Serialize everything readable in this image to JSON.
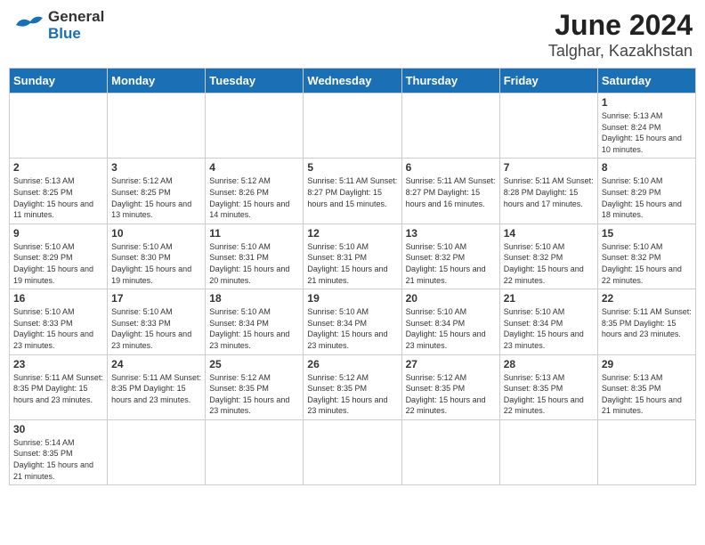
{
  "header": {
    "logo_general": "General",
    "logo_blue": "Blue",
    "month_year": "June 2024",
    "location": "Talghar, Kazakhstan"
  },
  "days_of_week": [
    "Sunday",
    "Monday",
    "Tuesday",
    "Wednesday",
    "Thursday",
    "Friday",
    "Saturday"
  ],
  "weeks": [
    [
      {
        "day": "",
        "info": ""
      },
      {
        "day": "",
        "info": ""
      },
      {
        "day": "",
        "info": ""
      },
      {
        "day": "",
        "info": ""
      },
      {
        "day": "",
        "info": ""
      },
      {
        "day": "",
        "info": ""
      },
      {
        "day": "1",
        "info": "Sunrise: 5:13 AM\nSunset: 8:24 PM\nDaylight: 15 hours\nand 10 minutes."
      }
    ],
    [
      {
        "day": "2",
        "info": "Sunrise: 5:13 AM\nSunset: 8:25 PM\nDaylight: 15 hours\nand 11 minutes."
      },
      {
        "day": "3",
        "info": "Sunrise: 5:12 AM\nSunset: 8:25 PM\nDaylight: 15 hours\nand 13 minutes."
      },
      {
        "day": "4",
        "info": "Sunrise: 5:12 AM\nSunset: 8:26 PM\nDaylight: 15 hours\nand 14 minutes."
      },
      {
        "day": "5",
        "info": "Sunrise: 5:11 AM\nSunset: 8:27 PM\nDaylight: 15 hours\nand 15 minutes."
      },
      {
        "day": "6",
        "info": "Sunrise: 5:11 AM\nSunset: 8:27 PM\nDaylight: 15 hours\nand 16 minutes."
      },
      {
        "day": "7",
        "info": "Sunrise: 5:11 AM\nSunset: 8:28 PM\nDaylight: 15 hours\nand 17 minutes."
      },
      {
        "day": "8",
        "info": "Sunrise: 5:10 AM\nSunset: 8:29 PM\nDaylight: 15 hours\nand 18 minutes."
      }
    ],
    [
      {
        "day": "9",
        "info": "Sunrise: 5:10 AM\nSunset: 8:29 PM\nDaylight: 15 hours\nand 19 minutes."
      },
      {
        "day": "10",
        "info": "Sunrise: 5:10 AM\nSunset: 8:30 PM\nDaylight: 15 hours\nand 19 minutes."
      },
      {
        "day": "11",
        "info": "Sunrise: 5:10 AM\nSunset: 8:31 PM\nDaylight: 15 hours\nand 20 minutes."
      },
      {
        "day": "12",
        "info": "Sunrise: 5:10 AM\nSunset: 8:31 PM\nDaylight: 15 hours\nand 21 minutes."
      },
      {
        "day": "13",
        "info": "Sunrise: 5:10 AM\nSunset: 8:32 PM\nDaylight: 15 hours\nand 21 minutes."
      },
      {
        "day": "14",
        "info": "Sunrise: 5:10 AM\nSunset: 8:32 PM\nDaylight: 15 hours\nand 22 minutes."
      },
      {
        "day": "15",
        "info": "Sunrise: 5:10 AM\nSunset: 8:32 PM\nDaylight: 15 hours\nand 22 minutes."
      }
    ],
    [
      {
        "day": "16",
        "info": "Sunrise: 5:10 AM\nSunset: 8:33 PM\nDaylight: 15 hours\nand 23 minutes."
      },
      {
        "day": "17",
        "info": "Sunrise: 5:10 AM\nSunset: 8:33 PM\nDaylight: 15 hours\nand 23 minutes."
      },
      {
        "day": "18",
        "info": "Sunrise: 5:10 AM\nSunset: 8:34 PM\nDaylight: 15 hours\nand 23 minutes."
      },
      {
        "day": "19",
        "info": "Sunrise: 5:10 AM\nSunset: 8:34 PM\nDaylight: 15 hours\nand 23 minutes."
      },
      {
        "day": "20",
        "info": "Sunrise: 5:10 AM\nSunset: 8:34 PM\nDaylight: 15 hours\nand 23 minutes."
      },
      {
        "day": "21",
        "info": "Sunrise: 5:10 AM\nSunset: 8:34 PM\nDaylight: 15 hours\nand 23 minutes."
      },
      {
        "day": "22",
        "info": "Sunrise: 5:11 AM\nSunset: 8:35 PM\nDaylight: 15 hours\nand 23 minutes."
      }
    ],
    [
      {
        "day": "23",
        "info": "Sunrise: 5:11 AM\nSunset: 8:35 PM\nDaylight: 15 hours\nand 23 minutes."
      },
      {
        "day": "24",
        "info": "Sunrise: 5:11 AM\nSunset: 8:35 PM\nDaylight: 15 hours\nand 23 minutes."
      },
      {
        "day": "25",
        "info": "Sunrise: 5:12 AM\nSunset: 8:35 PM\nDaylight: 15 hours\nand 23 minutes."
      },
      {
        "day": "26",
        "info": "Sunrise: 5:12 AM\nSunset: 8:35 PM\nDaylight: 15 hours\nand 23 minutes."
      },
      {
        "day": "27",
        "info": "Sunrise: 5:12 AM\nSunset: 8:35 PM\nDaylight: 15 hours\nand 22 minutes."
      },
      {
        "day": "28",
        "info": "Sunrise: 5:13 AM\nSunset: 8:35 PM\nDaylight: 15 hours\nand 22 minutes."
      },
      {
        "day": "29",
        "info": "Sunrise: 5:13 AM\nSunset: 8:35 PM\nDaylight: 15 hours\nand 21 minutes."
      }
    ],
    [
      {
        "day": "30",
        "info": "Sunrise: 5:14 AM\nSunset: 8:35 PM\nDaylight: 15 hours\nand 21 minutes."
      },
      {
        "day": "",
        "info": ""
      },
      {
        "day": "",
        "info": ""
      },
      {
        "day": "",
        "info": ""
      },
      {
        "day": "",
        "info": ""
      },
      {
        "day": "",
        "info": ""
      },
      {
        "day": "",
        "info": ""
      }
    ]
  ]
}
